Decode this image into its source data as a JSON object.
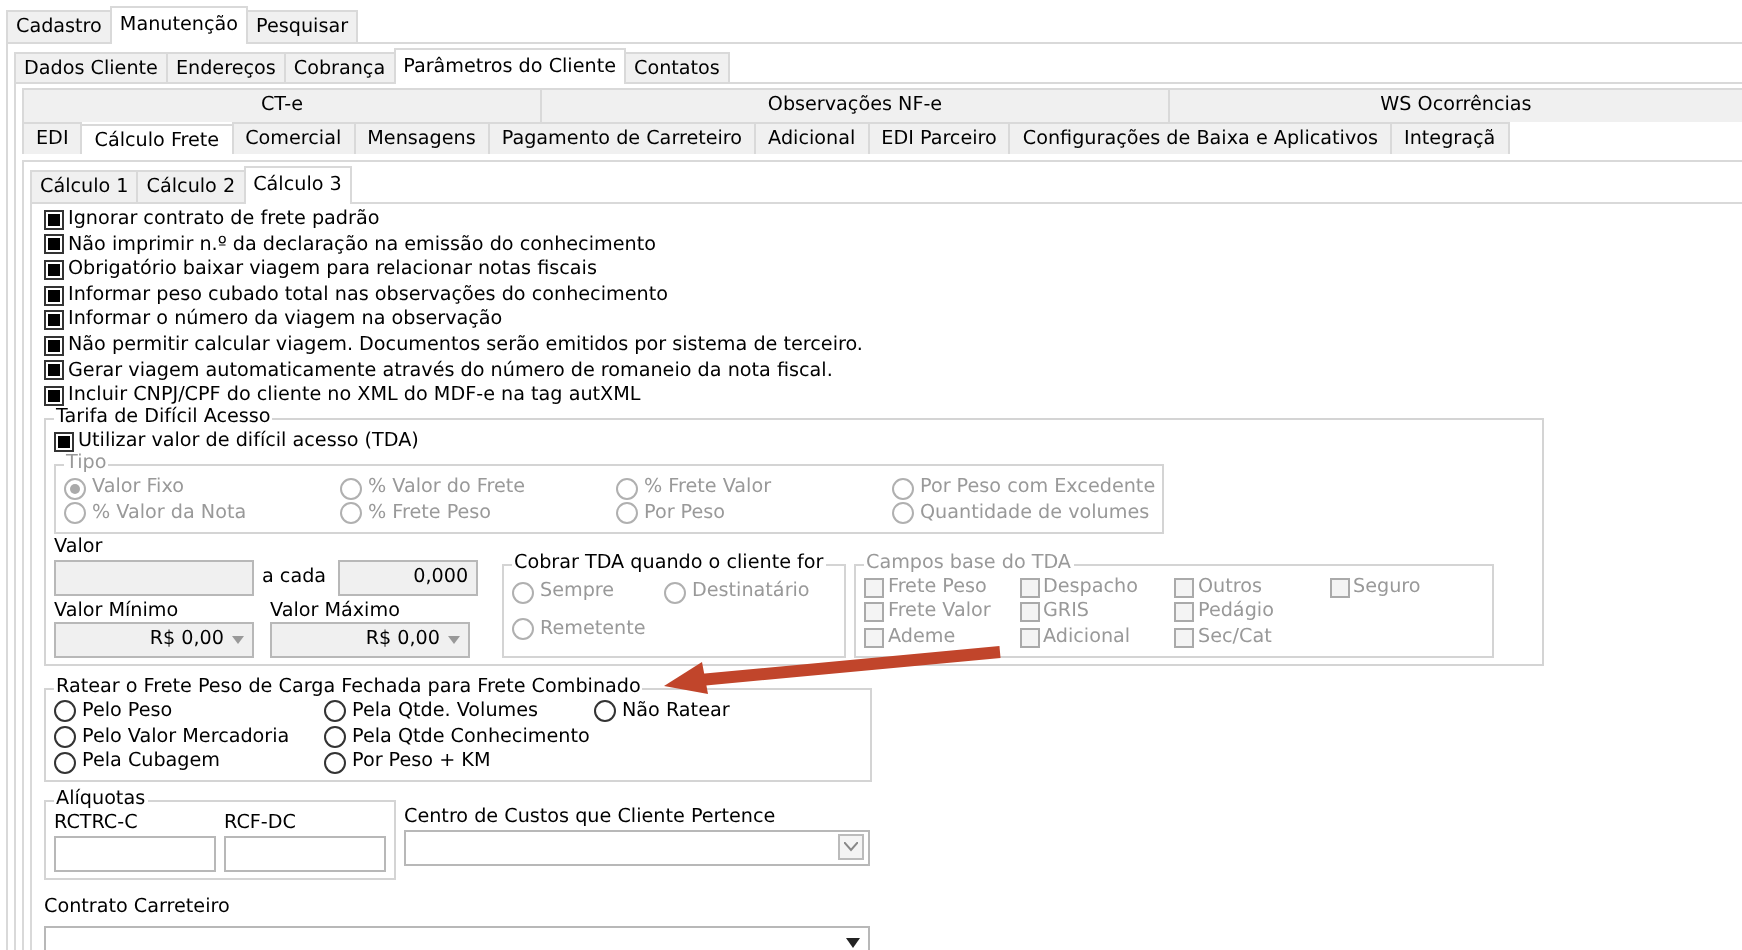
{
  "main_tabs": [
    {
      "label": "Cadastro",
      "selected": false
    },
    {
      "label": "Manutenção",
      "selected": true
    },
    {
      "label": "Pesquisar",
      "selected": false
    }
  ],
  "client_tabs": [
    {
      "label": "Dados Cliente",
      "selected": false
    },
    {
      "label": "Endereços",
      "selected": false
    },
    {
      "label": "Cobrança",
      "selected": false
    },
    {
      "label": "Parâmetros do Cliente",
      "selected": true
    },
    {
      "label": "Contatos",
      "selected": false
    }
  ],
  "param_tabs": {
    "row_1": [
      {
        "label": "CT-e",
        "selected": false
      },
      {
        "label": "Observações NF-e",
        "selected": false
      },
      {
        "label": "WS Ocorrências",
        "selected": false
      }
    ],
    "row_2": [
      {
        "label": "EDI",
        "selected": false
      },
      {
        "label": "Cálculo Frete",
        "selected": true
      },
      {
        "label": "Comercial",
        "selected": false
      },
      {
        "label": "Mensagens",
        "selected": false
      },
      {
        "label": "Pagamento de Carreteiro",
        "selected": false
      },
      {
        "label": "Adicional",
        "selected": false
      },
      {
        "label": "EDI Parceiro",
        "selected": false
      },
      {
        "label": "Configurações de Baixa e Aplicativos",
        "selected": false
      },
      {
        "label": "Integraçã",
        "selected": false
      }
    ]
  },
  "calc_tabs": [
    {
      "label": "Cálculo 1",
      "selected": false
    },
    {
      "label": "Cálculo 2",
      "selected": false
    },
    {
      "label": "Cálculo 3",
      "selected": true
    }
  ],
  "options": [
    {
      "label": "Ignorar contrato de frete padrão",
      "checked": true
    },
    {
      "label": "Não imprimir n.º da declaração na emissão do conhecimento",
      "checked": true
    },
    {
      "label": "Obrigatório baixar viagem para relacionar notas fiscais",
      "checked": true
    },
    {
      "label": "Informar peso cubado total nas observações do conhecimento",
      "checked": true
    },
    {
      "label": "Informar o número da viagem na observação",
      "checked": true
    },
    {
      "label": "Não permitir calcular viagem. Documentos serão emitidos por sistema de terceiro.",
      "checked": true
    },
    {
      "label": "Gerar viagem automaticamente através do número de romaneio da nota fiscal.",
      "checked": true
    },
    {
      "label": "Incluir CNPJ/CPF do cliente no XML do MDF-e na tag autXML",
      "checked": true
    }
  ],
  "tda": {
    "title": "Tarifa de Difícil Acesso",
    "use_tda": {
      "label": "Utilizar valor de difícil acesso (TDA)",
      "checked": true
    },
    "tipo": {
      "title": "Tipo",
      "disabled": true,
      "options": [
        {
          "label": "Valor Fixo",
          "selected": true
        },
        {
          "label": "% Valor do Frete",
          "selected": false
        },
        {
          "label": "% Frete Valor",
          "selected": false
        },
        {
          "label": "Por Peso com Excedente",
          "selected": false
        },
        {
          "label": "% Valor da Nota",
          "selected": false
        },
        {
          "label": "% Frete Peso",
          "selected": false
        },
        {
          "label": "Por Peso",
          "selected": false
        },
        {
          "label": "Quantidade de volumes",
          "selected": false
        }
      ]
    },
    "valor": {
      "label": "Valor"
    },
    "a_cada": {
      "label": "a cada",
      "value": "0,000"
    },
    "valor_minimo": {
      "label": "Valor Mínimo",
      "value": "R$ 0,00"
    },
    "valor_maximo": {
      "label": "Valor Máximo",
      "value": "R$ 0,00"
    },
    "cobrar": {
      "title": "Cobrar TDA quando o cliente for",
      "disabled": true,
      "options": [
        {
          "label": "Sempre",
          "selected": false
        },
        {
          "label": "Destinatário",
          "selected": false
        },
        {
          "label": "Remetente",
          "selected": false
        }
      ]
    },
    "campos_base": {
      "title": "Campos base do TDA",
      "disabled": true,
      "columns": [
        [
          {
            "label": "Frete Peso",
            "checked": false
          },
          {
            "label": "Frete Valor",
            "checked": false
          },
          {
            "label": "Ademe",
            "checked": false
          }
        ],
        [
          {
            "label": "Despacho",
            "checked": false
          },
          {
            "label": "GRIS",
            "checked": false
          },
          {
            "label": "Adicional",
            "checked": false
          }
        ],
        [
          {
            "label": "Outros",
            "checked": false
          },
          {
            "label": "Pedágio",
            "checked": false
          },
          {
            "label": "Sec/Cat",
            "checked": false
          }
        ],
        [
          {
            "label": "Seguro",
            "checked": false
          }
        ]
      ]
    }
  },
  "ratear": {
    "title": "Ratear o Frete Peso de Carga Fechada para Frete Combinado",
    "columns": [
      [
        {
          "label": "Pelo Peso",
          "selected": false
        },
        {
          "label": "Pelo Valor Mercadoria",
          "selected": false
        },
        {
          "label": "Pela Cubagem",
          "selected": false
        }
      ],
      [
        {
          "label": "Pela Qtde. Volumes",
          "selected": false
        },
        {
          "label": "Pela Qtde Conhecimento",
          "selected": false
        },
        {
          "label": "Por Peso + KM",
          "selected": false
        }
      ],
      [
        {
          "label": "Não Ratear",
          "selected": false
        }
      ]
    ]
  },
  "aliquotas": {
    "title": "Alíquotas",
    "fields": [
      {
        "label": "RCTRC-C"
      },
      {
        "label": "RCF-DC"
      }
    ]
  },
  "centro_custos": {
    "label": "Centro de Custos que Cliente Pertence"
  },
  "contrato_carreteiro": {
    "label": "Contrato Carreteiro"
  }
}
